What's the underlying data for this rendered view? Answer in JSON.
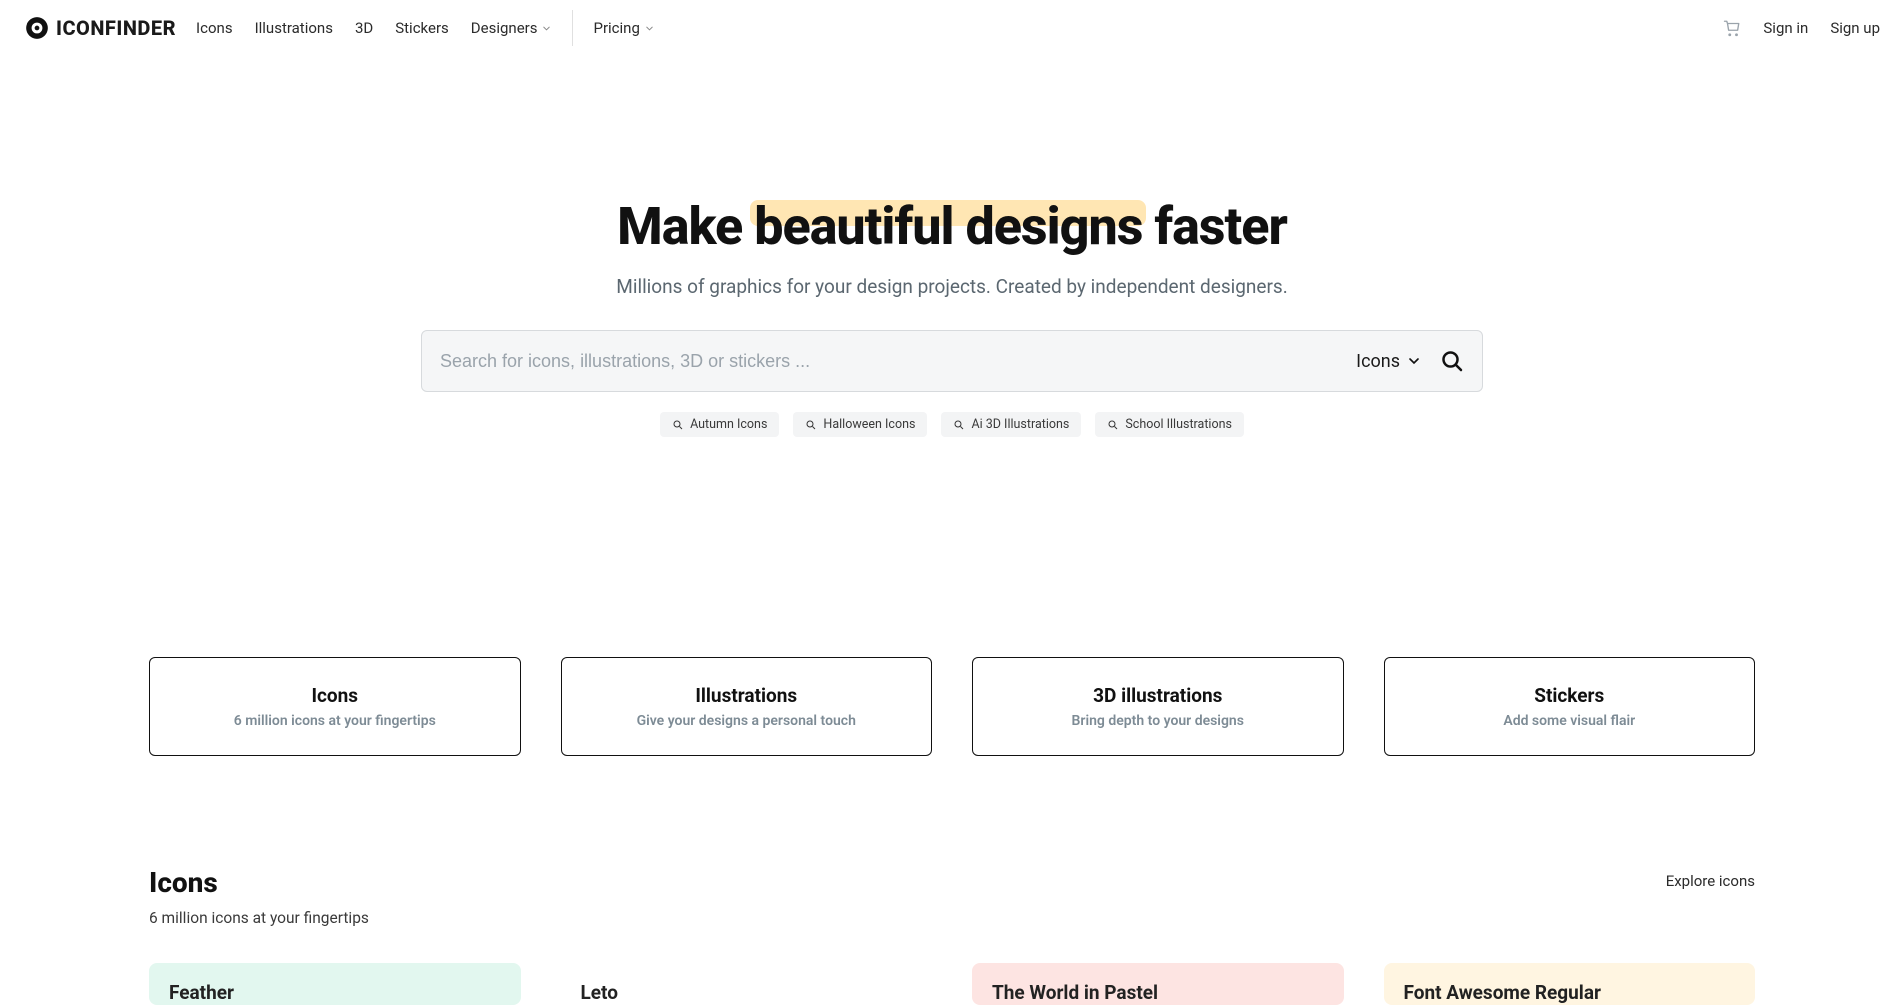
{
  "brand": "ICONFINDER",
  "nav": {
    "icons": "Icons",
    "illustrations": "Illustrations",
    "threed": "3D",
    "stickers": "Stickers",
    "designers": "Designers",
    "pricing": "Pricing",
    "signin": "Sign in",
    "signup": "Sign up"
  },
  "hero": {
    "title_prefix": "Make ",
    "title_highlight": "beautiful designs",
    "title_suffix": " faster",
    "subtitle": "Millions of graphics for your design projects. Created by independent designers.",
    "search_placeholder": "Search for icons, illustrations, 3D or stickers ...",
    "search_type": "Icons"
  },
  "suggestions": [
    "Autumn Icons",
    "Halloween Icons",
    "Ai 3D Illustrations",
    "School Illustrations"
  ],
  "categories": [
    {
      "title": "Icons",
      "sub": "6 million icons at your fingertips"
    },
    {
      "title": "Illustrations",
      "sub": "Give your designs a personal touch"
    },
    {
      "title": "3D illustrations",
      "sub": "Bring depth to your designs"
    },
    {
      "title": "Stickers",
      "sub": "Add some visual flair"
    }
  ],
  "section": {
    "title": "Icons",
    "subtitle": "6 million icons at your fingertips",
    "explore": "Explore icons"
  },
  "packs": [
    {
      "title": "Feather",
      "cls": "pack-feather"
    },
    {
      "title": "Leto",
      "cls": "pack-leto"
    },
    {
      "title": "The World in Pastel",
      "cls": "pack-world"
    },
    {
      "title": "Font Awesome Regular",
      "cls": "pack-fa"
    }
  ]
}
